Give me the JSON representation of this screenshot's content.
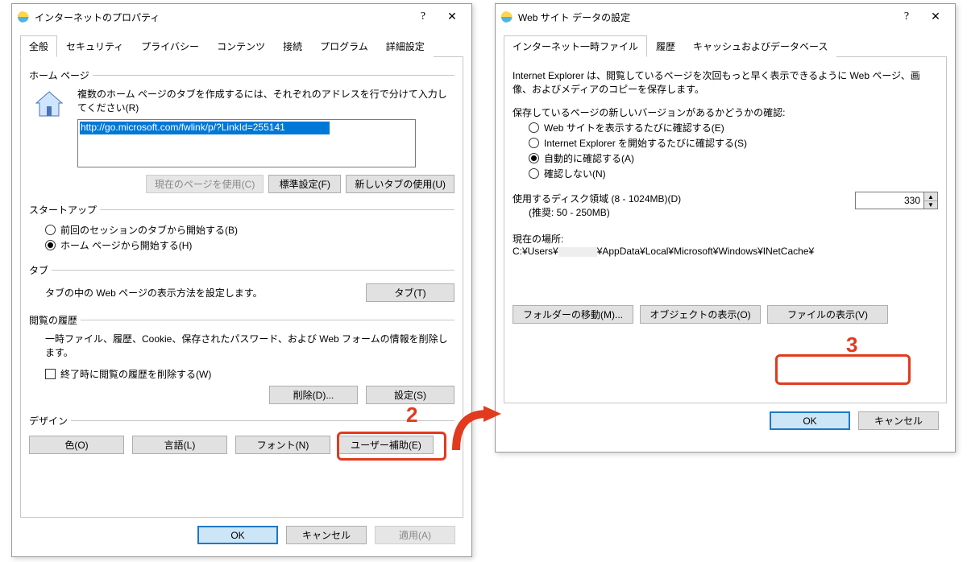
{
  "win1": {
    "title": "インターネットのプロパティ",
    "tabs": [
      "全般",
      "セキュリティ",
      "プライバシー",
      "コンテンツ",
      "接続",
      "プログラム",
      "詳細設定"
    ],
    "homepage": {
      "legend": "ホーム ページ",
      "desc": "複数のホーム ページのタブを作成するには、それぞれのアドレスを行で分けて入力してください(R)",
      "url": "http://go.microsoft.com/fwlink/p/?LinkId=255141",
      "btn_current": "現在のページを使用(C)",
      "btn_default": "標準設定(F)",
      "btn_newtab": "新しいタブの使用(U)"
    },
    "startup": {
      "legend": "スタートアップ",
      "opt1": "前回のセッションのタブから開始する(B)",
      "opt2": "ホーム ページから開始する(H)"
    },
    "tabsGrp": {
      "legend": "タブ",
      "desc": "タブの中の Web ページの表示方法を設定します。",
      "btn": "タブ(T)"
    },
    "history": {
      "legend": "閲覧の履歴",
      "desc": "一時ファイル、履歴、Cookie、保存されたパスワード、および Web フォームの情報を削除します。",
      "chk": "終了時に閲覧の履歴を削除する(W)",
      "btn_delete": "削除(D)...",
      "btn_settings": "設定(S)"
    },
    "design": {
      "legend": "デザイン",
      "btn_color": "色(O)",
      "btn_lang": "言語(L)",
      "btn_font": "フォント(N)",
      "btn_access": "ユーザー補助(E)"
    },
    "footer": {
      "ok": "OK",
      "cancel": "キャンセル",
      "apply": "適用(A)"
    }
  },
  "win2": {
    "title": "Web サイト データの設定",
    "tabs": [
      "インターネット一時ファイル",
      "履歴",
      "キャッシュおよびデータベース"
    ],
    "intro": "Internet Explorer は、閲覧しているページを次回もっと早く表示できるように Web ページ、画像、およびメディアのコピーを保存します。",
    "check_legend": "保存しているページの新しいバージョンがあるかどうかの確認:",
    "opts": [
      "Web サイトを表示するたびに確認する(E)",
      "Internet Explorer を開始するたびに確認する(S)",
      "自動的に確認する(A)",
      "確認しない(N)"
    ],
    "disk_label": "使用するディスク領域 (8 - 1024MB)(D)",
    "disk_hint": "(推奨: 50 - 250MB)",
    "disk_value": "330",
    "loc_label": "現在の場所:",
    "loc_path_prefix": "C:¥Users¥",
    "loc_path_suffix": "¥AppData¥Local¥Microsoft¥Windows¥INetCache¥",
    "btn_move": "フォルダーの移動(M)...",
    "btn_obj": "オブジェクトの表示(O)",
    "btn_files": "ファイルの表示(V)",
    "footer": {
      "ok": "OK",
      "cancel": "キャンセル"
    }
  },
  "callouts": {
    "n2": "2",
    "n3": "3"
  }
}
